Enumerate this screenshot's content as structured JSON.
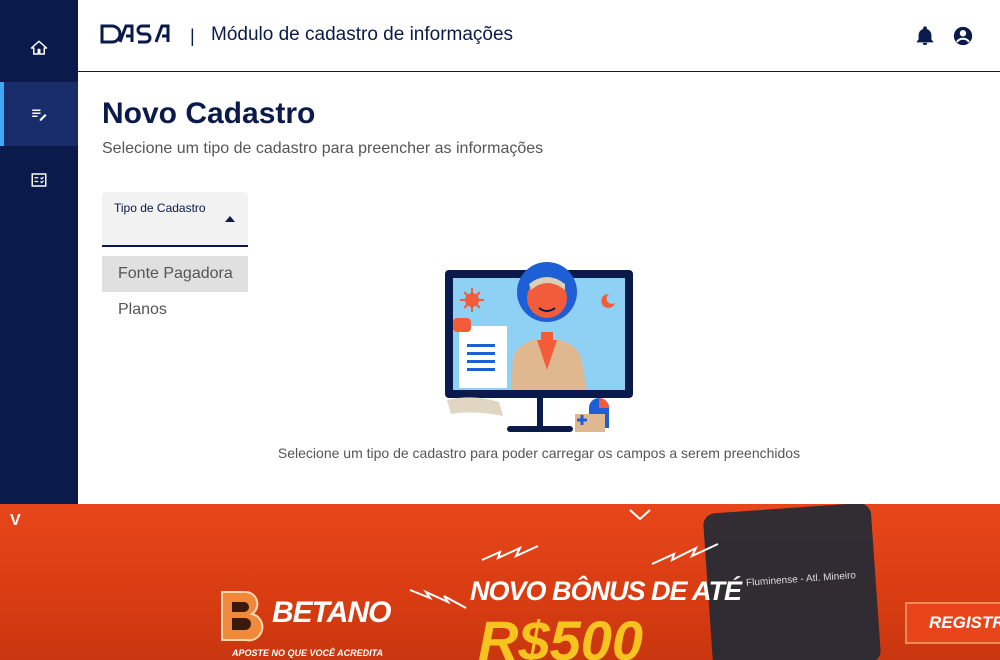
{
  "header": {
    "logo_text": "DASA",
    "separator": "|",
    "app_title": "Módulo de cadastro de informações"
  },
  "sidebar": {
    "items": [
      {
        "icon": "home-icon",
        "active": false
      },
      {
        "icon": "edit-list-icon",
        "active": true
      },
      {
        "icon": "checklist-icon",
        "active": false
      }
    ]
  },
  "main": {
    "title": "Novo Cadastro",
    "subtitle": "Selecione um tipo de cadastro para preencher as informações",
    "select": {
      "label": "Tipo de Cadastro",
      "value": ""
    },
    "options": [
      "Fonte Pagadora",
      "Planos"
    ],
    "hint": "Selecione um tipo de cadastro para poder carregar os campos a serem preenchidos"
  },
  "ad": {
    "badge": "V",
    "brand": "BETANO",
    "tagline": "APOSTE NO QUE VOCÊ ACREDITA",
    "headline": "NOVO BÔNUS DE ATÉ",
    "amount": "R$500",
    "match": "Fluminense - Atl. Mineiro",
    "cta": "REGISTRE"
  },
  "colors": {
    "navy": "#0a1a4a",
    "accent": "#3fa9f5",
    "ad_orange": "#e8461a",
    "ad_yellow": "#f7c31e"
  }
}
